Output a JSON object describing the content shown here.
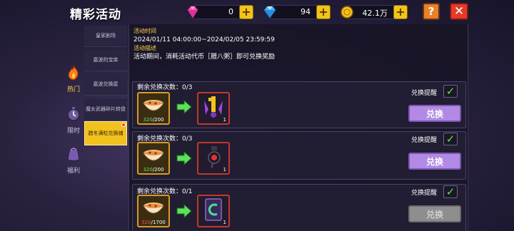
{
  "header": {
    "title": "精彩活动"
  },
  "resources": [
    {
      "name": "gem",
      "icon": "pink-gem-icon",
      "value": "0"
    },
    {
      "name": "diamond",
      "icon": "blue-diamond-icon",
      "value": "94"
    },
    {
      "name": "coin",
      "icon": "gold-coin-icon",
      "value": "42.1万"
    }
  ],
  "buttons": {
    "help": "?",
    "close": "✕",
    "plus": "+"
  },
  "side_nav": [
    {
      "label": "热门",
      "icon": "fire-icon",
      "active": true
    },
    {
      "label": "限时",
      "icon": "clock-icon",
      "active": false
    },
    {
      "label": "福利",
      "icon": "gift-bag-icon",
      "active": false
    }
  ],
  "tabs": [
    {
      "label": "皇家剧场"
    },
    {
      "label": "嘉波的宝库"
    },
    {
      "label": "嘉波兑换屋"
    },
    {
      "label": "魔女武器碎片转盘"
    },
    {
      "label": "腊冬满粒兑换铺",
      "active": true
    }
  ],
  "info": {
    "time_heading": "活动时间",
    "time_value": "2024/01/11 04:00:00~2024/02/05 23:59:59",
    "desc_heading": "活动描述",
    "desc_value": "活动期间，消耗活动代币［腊八粥］即可兑换奖励"
  },
  "exchange_items": [
    {
      "remaining": "剩余兑换次数：0/3",
      "have": "320",
      "need": "/200",
      "enough": true,
      "reward_icon": "purple-key-icon",
      "reward_qty": "1",
      "remind_label": "兑换提醒",
      "remind_on": true,
      "button": "兑换",
      "button_enabled": true
    },
    {
      "remaining": "剩余兑换次数：0/3",
      "have": "320",
      "need": "/200",
      "enough": true,
      "reward_icon": "red-potion-icon",
      "reward_qty": "1",
      "remind_label": "兑换提醒",
      "remind_on": true,
      "button": "兑换",
      "button_enabled": true
    },
    {
      "remaining": "剩余兑换次数：0/1",
      "have": "320",
      "need": "/1700",
      "enough": false,
      "reward_icon": "green-card-icon",
      "reward_qty": "1",
      "remind_label": "兑换提醒",
      "remind_on": true,
      "button": "兑换",
      "button_enabled": false
    }
  ],
  "colors": {
    "accent_gold": "#f1c11e",
    "button_purple": "#b28ae6",
    "ok_green": "#5de05a",
    "bad_red": "#ff4a4a"
  }
}
